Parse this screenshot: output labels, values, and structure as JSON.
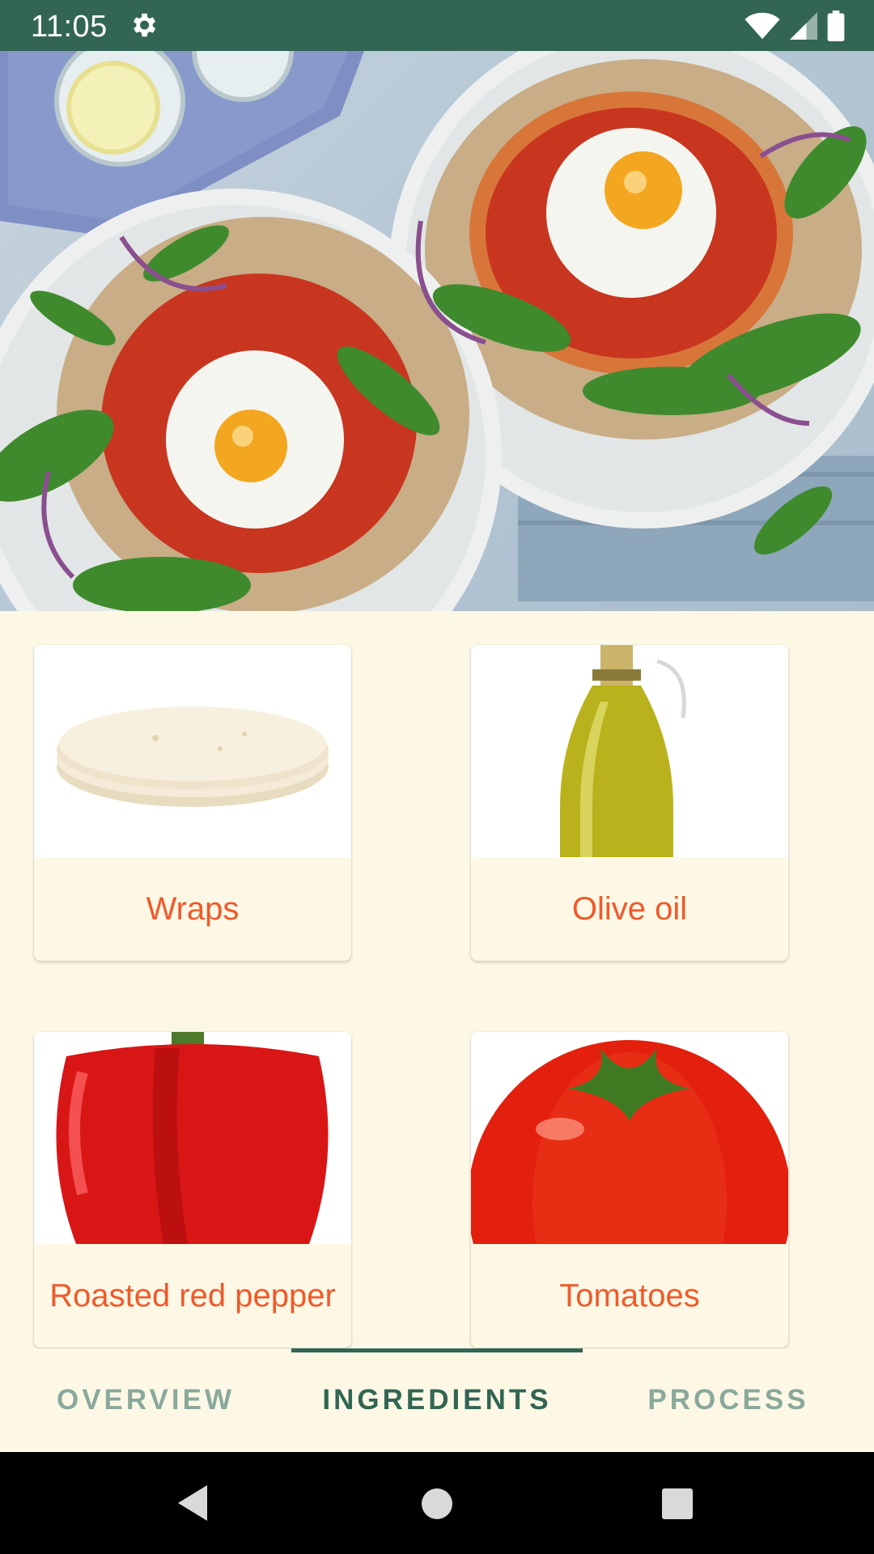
{
  "status_bar": {
    "time": "11:05",
    "settings_icon": "gear-icon",
    "wifi_icon": "wifi-icon",
    "signal_icon": "signal-icon",
    "battery_icon": "battery-icon",
    "background_color": "#326553"
  },
  "hero": {
    "image": "pizza-plates-with-eggs"
  },
  "ingredients": [
    {
      "label": "Wraps",
      "image": "tortilla-wraps"
    },
    {
      "label": "Olive oil",
      "image": "olive-oil-bottle"
    },
    {
      "label": "Roasted red pepper",
      "image": "red-pepper"
    },
    {
      "label": "Tomatoes",
      "image": "tomato"
    }
  ],
  "tabs": [
    {
      "label": "OVERVIEW",
      "active": false
    },
    {
      "label": "INGREDIENTS",
      "active": true
    },
    {
      "label": "PROCESS",
      "active": false
    }
  ],
  "nav_bar": {
    "back_icon": "back-triangle-icon",
    "home_icon": "home-circle-icon",
    "recents_icon": "recents-square-icon"
  },
  "colors": {
    "accent": "#f1592a",
    "primary": "#326553",
    "background": "#fdf8e6"
  }
}
